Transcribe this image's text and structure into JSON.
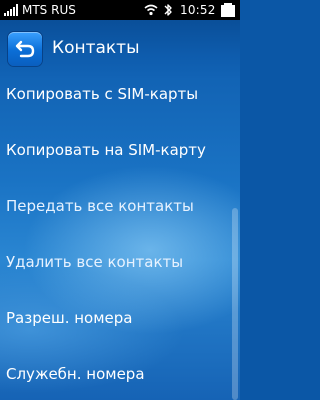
{
  "status_bar": {
    "carrier": "MTS RUS",
    "time": "10:52",
    "icons": [
      "signal-icon",
      "wifi-icon",
      "bluetooth-icon",
      "battery-icon"
    ]
  },
  "header": {
    "back_icon": "back-arrow-icon",
    "title": "Контакты"
  },
  "menu": {
    "items": [
      {
        "label": "Копировать с SIM-карты"
      },
      {
        "label": "Копировать на SIM-карту"
      },
      {
        "label": "Передать все контакты"
      },
      {
        "label": "Удалить все контакты"
      },
      {
        "label": "Разреш. номера"
      },
      {
        "label": "Служебн. номера"
      }
    ]
  },
  "colors": {
    "accent": "#3aa0ff",
    "background": "#1a73c4",
    "text": "#ffffff"
  }
}
